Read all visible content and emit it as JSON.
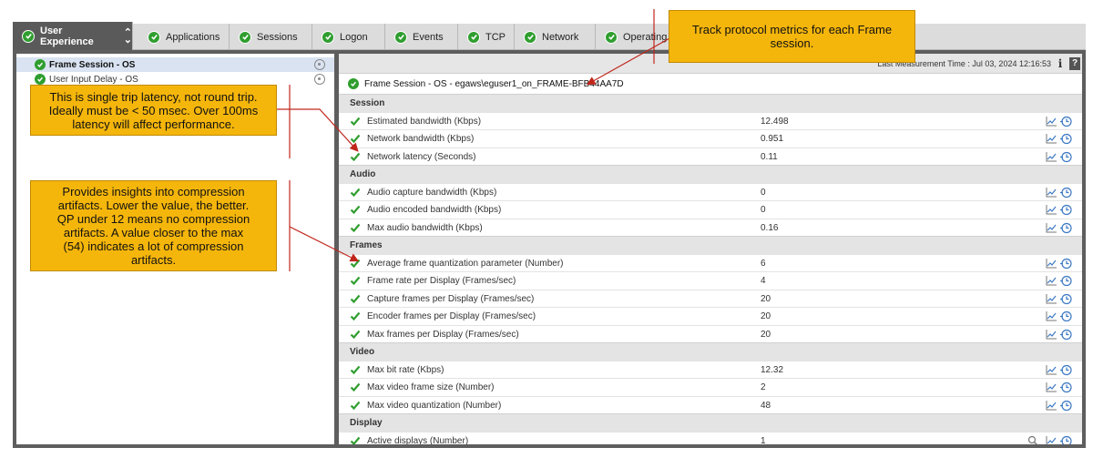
{
  "tabs": [
    {
      "label": "User Experience",
      "active": true
    },
    {
      "label": "Applications"
    },
    {
      "label": "Sessions"
    },
    {
      "label": "Logon"
    },
    {
      "label": "Events"
    },
    {
      "label": "TCP"
    },
    {
      "label": "Network"
    },
    {
      "label": "Operating"
    }
  ],
  "tree": [
    {
      "label": "Frame Session - OS",
      "selected": true
    },
    {
      "label": "User Input Delay - OS",
      "selected": false
    }
  ],
  "header": {
    "last_measurement": "Last Measurement Time : Jul 03, 2024 12:16:53",
    "info_icon": "i",
    "help_icon": "?"
  },
  "session": {
    "title": "Frame Session - OS - egaws\\eguser1_on_FRAME-BFB44AA7D"
  },
  "sections": [
    {
      "name": "Session",
      "rows": [
        {
          "name": "Estimated bandwidth (Kbps)",
          "value": "12.498"
        },
        {
          "name": "Network bandwidth (Kbps)",
          "value": "0.951"
        },
        {
          "name": "Network latency (Seconds)",
          "value": "0.11"
        }
      ]
    },
    {
      "name": "Audio",
      "rows": [
        {
          "name": "Audio capture bandwidth (Kbps)",
          "value": "0"
        },
        {
          "name": "Audio encoded bandwidth (Kbps)",
          "value": "0"
        },
        {
          "name": "Max audio bandwidth (Kbps)",
          "value": "0.16"
        }
      ]
    },
    {
      "name": "Frames",
      "rows": [
        {
          "name": "Average frame quantization parameter (Number)",
          "value": "6"
        },
        {
          "name": "Frame rate per Display (Frames/sec)",
          "value": "4"
        },
        {
          "name": "Capture frames per Display (Frames/sec)",
          "value": "20"
        },
        {
          "name": "Encoder frames per Display (Frames/sec)",
          "value": "20"
        },
        {
          "name": "Max frames per Display (Frames/sec)",
          "value": "20"
        }
      ]
    },
    {
      "name": "Video",
      "rows": [
        {
          "name": "Max bit rate (Kbps)",
          "value": "12.32"
        },
        {
          "name": "Max video frame size (Number)",
          "value": "2"
        },
        {
          "name": "Max video quantization (Number)",
          "value": "48"
        }
      ]
    },
    {
      "name": "Display",
      "rows": [
        {
          "name": "Active displays (Number)",
          "value": "1",
          "zoom": true
        }
      ]
    }
  ],
  "callouts": {
    "protocol": [
      "Track protocol metrics for each Frame",
      "session."
    ],
    "latency": [
      "This is single trip latency, not round trip.",
      "Ideally must be < 50 msec. Over 100ms",
      "latency will affect performance."
    ],
    "compression": [
      "Provides insights into compression",
      "artifacts. Lower the value, the better.",
      "QP under 12 means no compression",
      "artifacts. A value closer to the max",
      "(54) indicates a lot of compression",
      "artifacts."
    ]
  },
  "colors": {
    "ok_green": "#2f9e2f",
    "callout_fill": "#f5b60c",
    "arrow_red": "#c0261c",
    "frame_border": "#5e5e5e"
  }
}
